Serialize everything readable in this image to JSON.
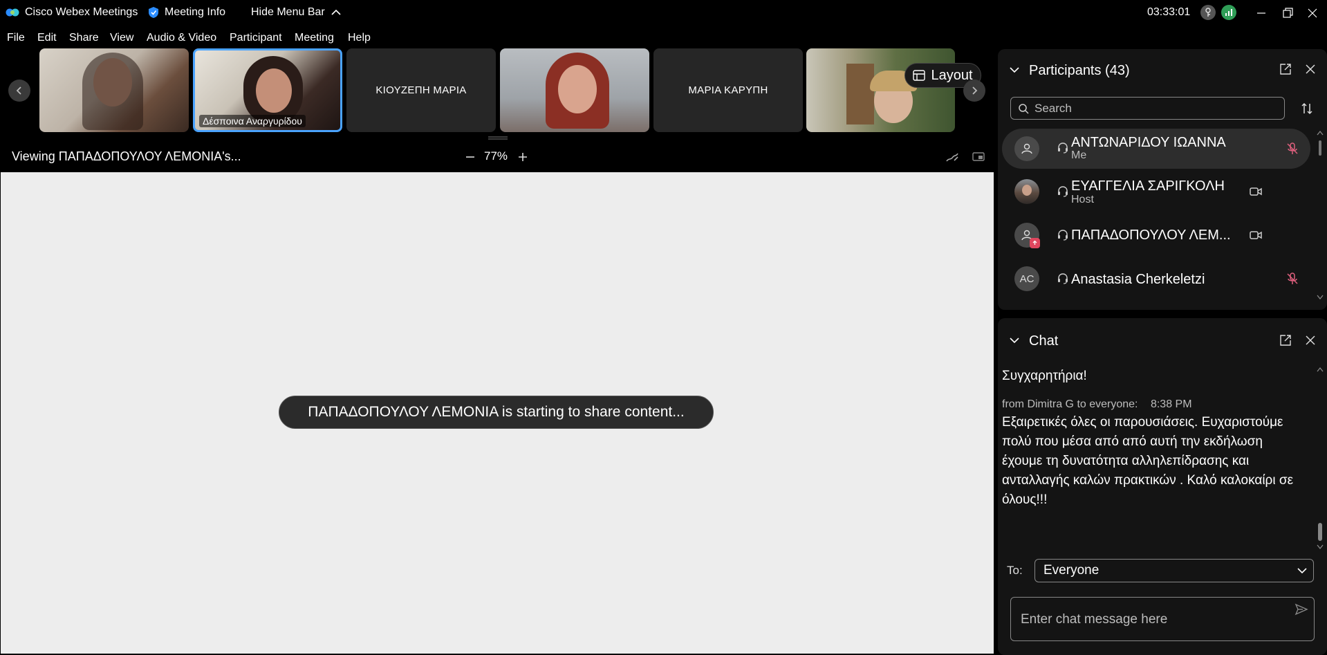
{
  "titlebar": {
    "app_name": "Cisco Webex Meetings",
    "meeting_info": "Meeting Info",
    "hide_menu_bar": "Hide Menu Bar",
    "clock": "03:33:01"
  },
  "menu": {
    "items": [
      "File",
      "Edit",
      "Share",
      "View",
      "Audio & Video",
      "Participant",
      "Meeting",
      "Help"
    ]
  },
  "filmstrip": {
    "tiles": [
      {
        "label": ""
      },
      {
        "label": "Δέσποινα Αναργυρίδου"
      },
      {
        "label": "ΚΙΟΥΖΕΠΗ ΜΑΡΙΑ"
      },
      {
        "label": ""
      },
      {
        "label": "ΜΑΡΙΑ ΚΑΡΥΠΗ"
      },
      {
        "label": ""
      }
    ],
    "layout_label": "Layout"
  },
  "viewing": {
    "title": "Viewing ΠΑΠΑΔΟΠΟΥΛΟΥ ΛΕΜΟΝΙΑ's...",
    "zoom": "77%"
  },
  "stage": {
    "message": "ΠΑΠΑΔΟΠΟΥΛΟΥ ΛΕΜΟΝΙΑ is starting to share content..."
  },
  "participants": {
    "title": "Participants (43)",
    "search_placeholder": "Search",
    "list": [
      {
        "name": "ΑΝΤΩΝΑΡΙΔΟΥ ΙΩΑΝΝΑ",
        "role": "Me",
        "status": "muted",
        "avatar": "person-icon"
      },
      {
        "name": "ΕΥΑΓΓΕΛΙΑ ΣΑΡΙΓΚΟΛΗ",
        "role": "Host",
        "status": "video",
        "avatar": "photo"
      },
      {
        "name": "ΠΑΠΑΔΟΠΟΥΛΟΥ ΛΕΜ...",
        "role": "",
        "status": "video",
        "avatar": "sharing-icon"
      },
      {
        "name": "Anastasia Cherkeletzi",
        "role": "",
        "status": "muted",
        "avatar": "AC"
      }
    ]
  },
  "chat": {
    "title": "Chat",
    "messages": [
      {
        "meta": "",
        "time": "",
        "text": "Συγχαρητήρια!"
      },
      {
        "meta": "from Dimitra G to everyone:",
        "time": "8:38 PM",
        "text": "Εξαιρετικές όλες οι παρουσιάσεις. Ευχαριστούμε πολύ που μέσα από από αυτή την εκδήλωση έχουμε τη δυνατότητα αλληλεπίδρασης και ανταλλαγής καλών πρακτικών . Καλό καλοκαίρι σε όλους!!!"
      }
    ],
    "to_label": "To:",
    "to_value": "Everyone",
    "input_placeholder": "Enter chat message here"
  },
  "colors": {
    "accent": "#4aa3ff",
    "muted_red": "#e0607e",
    "stage_bg": "#ededed"
  }
}
